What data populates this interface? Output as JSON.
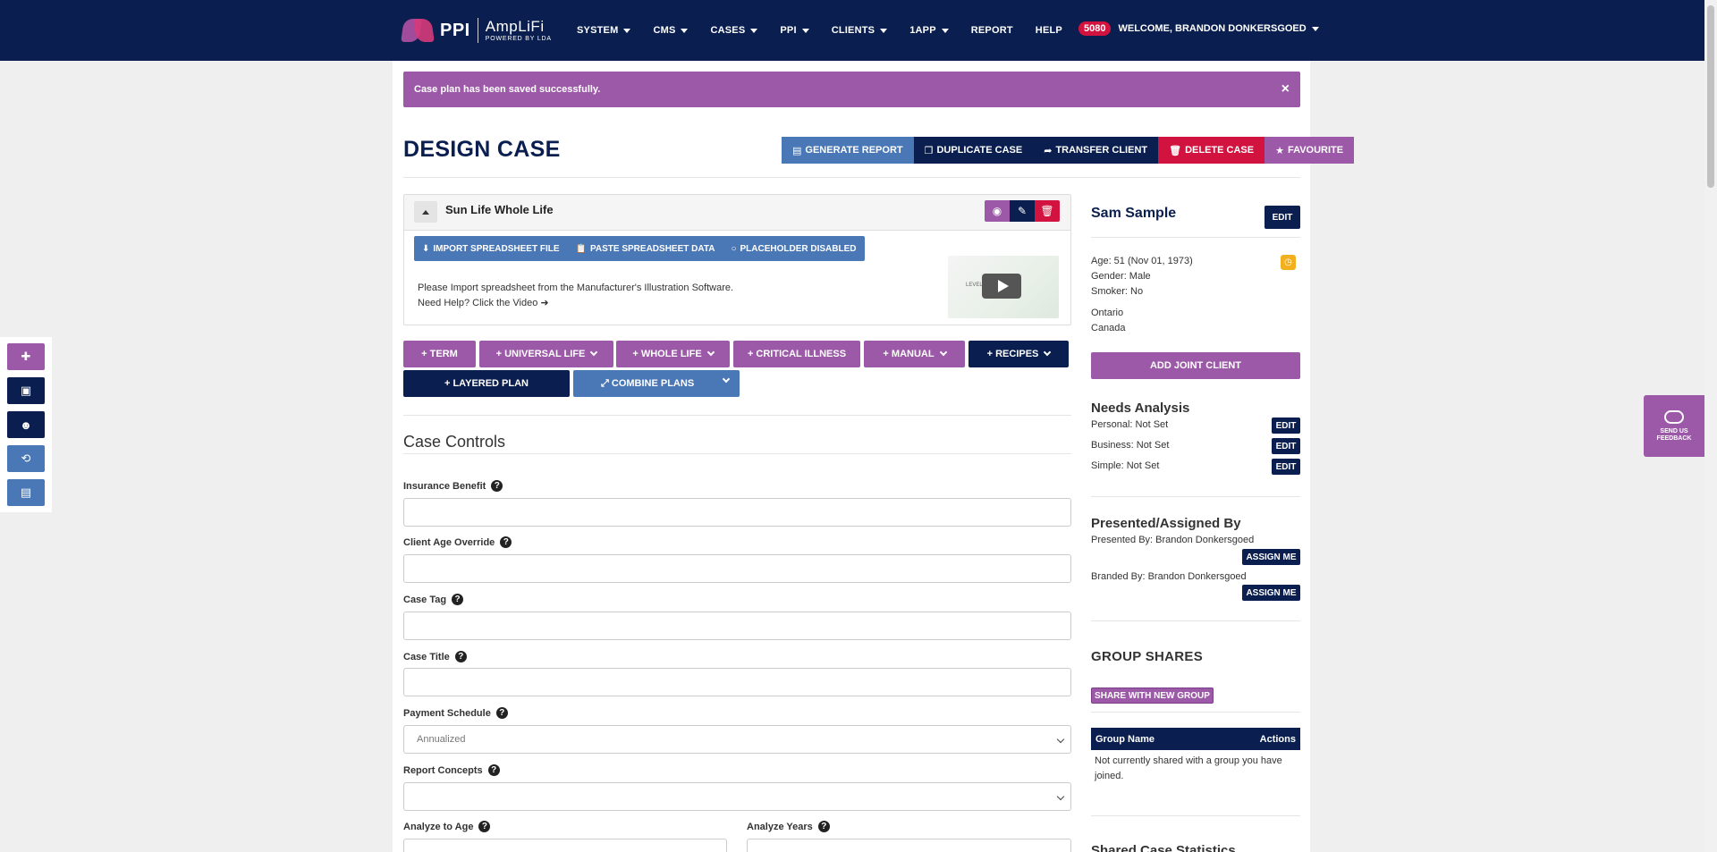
{
  "nav": {
    "logo_ppi": "PPI",
    "logo_amplifi": "AmpLiFi",
    "logo_powered": "POWERED BY LDA",
    "menu": [
      "SYSTEM",
      "CMS",
      "CASES",
      "PPI",
      "CLIENTS",
      "1APP",
      "REPORT",
      "HELP"
    ],
    "badge": "5080",
    "welcome": "WELCOME, BRANDON DONKERSGOED"
  },
  "alert": {
    "message": "Case plan has been saved successfully.",
    "close": "×"
  },
  "page_title": "DESIGN CASE",
  "actions": {
    "generate_report": "GENERATE REPORT",
    "duplicate_case": "DUPLICATE CASE",
    "transfer_client": "TRANSFER CLIENT",
    "delete_case": "DELETE CASE",
    "favourite": "FAVOURITE"
  },
  "plan": {
    "name": "Sun Life Whole Life",
    "import_file": "IMPORT SPREADSHEET FILE",
    "paste_data": "PASTE SPREADSHEET DATA",
    "placeholder": "PLACEHOLDER DISABLED",
    "instructions": "Please Import spreadsheet from the Manufacturer's Illustration Software.",
    "help": "Need Help? Click the Video",
    "video_label": "LEVEL ANALYSIS"
  },
  "plan_buttons": {
    "term": "TERM",
    "universal_life": "UNIVERSAL LIFE",
    "whole_life": "WHOLE LIFE",
    "critical_illness": "CRITICAL ILLNESS",
    "manual": "MANUAL",
    "recipes": "RECIPES",
    "layered_plan": "LAYERED PLAN",
    "combine_plans": "COMBINE PLANS"
  },
  "case_controls": {
    "title": "Case Controls",
    "insurance_benefit": {
      "label": "Insurance Benefit",
      "value": ""
    },
    "client_age_override": {
      "label": "Client Age Override",
      "value": ""
    },
    "case_tag": {
      "label": "Case Tag",
      "value": ""
    },
    "case_title": {
      "label": "Case Title",
      "value": ""
    },
    "payment_schedule": {
      "label": "Payment Schedule",
      "value": "Annualized"
    },
    "report_concepts": {
      "label": "Report Concepts",
      "value": ""
    },
    "analyze_to_age": {
      "label": "Analyze to Age",
      "value": ""
    },
    "analyze_years": {
      "label": "Analyze Years",
      "value": ""
    }
  },
  "client": {
    "name": "Sam Sample",
    "edit": "EDIT",
    "age": "Age: 51 (Nov 01, 1973)",
    "gender": "Gender: Male",
    "smoker": "Smoker: No",
    "province": "Ontario",
    "country": "Canada",
    "add_joint": "ADD JOINT CLIENT"
  },
  "needs": {
    "title": "Needs Analysis",
    "personal": "Personal: Not Set",
    "business": "Business: Not Set",
    "simple": "Simple: Not Set",
    "edit": "EDIT"
  },
  "presented": {
    "title": "Presented/Assigned By",
    "presented_by": "Presented By: Brandon Donkersgoed",
    "branded_by": "Branded By: Brandon Donkersgoed",
    "assign": "ASSIGN ME"
  },
  "group_shares": {
    "title": "GROUP SHARES",
    "share_btn": "SHARE WITH NEW GROUP",
    "col_name": "Group Name",
    "col_actions": "Actions",
    "empty": "Not currently shared with a group you have joined."
  },
  "cut_off_title": "Shared Case Statistics",
  "feedback": {
    "line1": "SEND US",
    "line2": "FEEDBACK"
  },
  "colors": {
    "navy": "#0a1f4f",
    "purple": "#9b59a7",
    "blue": "#4a77b5",
    "red": "#d2133f"
  }
}
